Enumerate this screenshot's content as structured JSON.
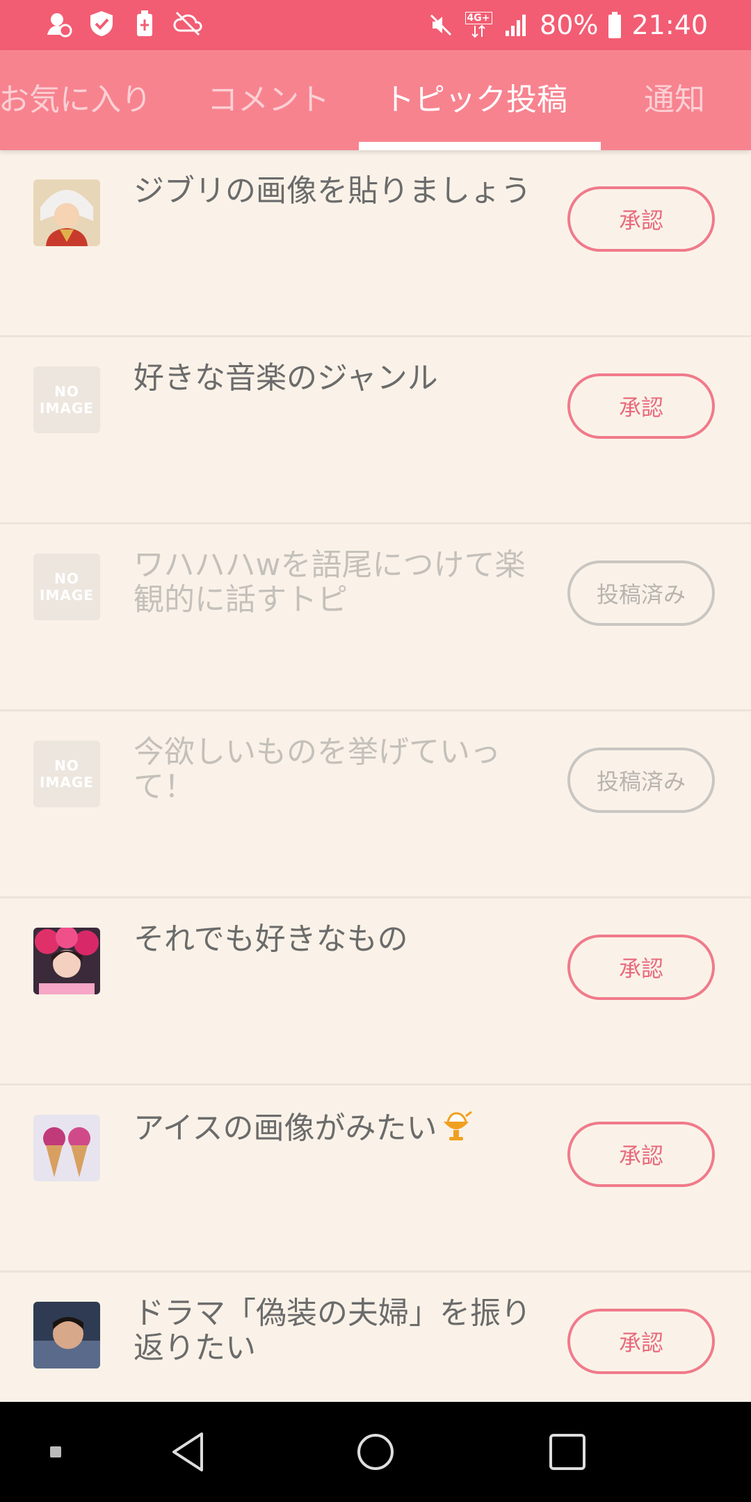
{
  "status": {
    "network": "4G+",
    "battery": "80%",
    "time": "21:40"
  },
  "tabs": [
    {
      "label": "お気に入り",
      "active": false
    },
    {
      "label": "コメント",
      "active": false
    },
    {
      "label": "トピック投稿",
      "active": true
    },
    {
      "label": "通知",
      "active": false
    }
  ],
  "no_image": {
    "line1": "NO",
    "line2": "IMAGE"
  },
  "topics": [
    {
      "title": "ジブリの画像を貼りましょう",
      "button": "承認",
      "thumb": "ghibli-character-image",
      "posted": false
    },
    {
      "title": "好きな音楽のジャンル",
      "button": "承認",
      "thumb": "no-image",
      "posted": false
    },
    {
      "title": "ワハハハwを語尾につけて楽観的に話すトピ",
      "button": "投稿済み",
      "thumb": "no-image",
      "posted": true
    },
    {
      "title": "今欲しいものを挙げていって！",
      "button": "投稿済み",
      "thumb": "no-image",
      "posted": true
    },
    {
      "title": "それでも好きなもの",
      "button": "承認",
      "thumb": "girl-flowers-image",
      "posted": false
    },
    {
      "title": "アイスの画像がみたい",
      "button": "承認",
      "thumb": "ice-cream-image",
      "posted": false,
      "emoji": "ice-cream-icon"
    },
    {
      "title": "ドラマ「偽装の夫婦」を振り返りたい",
      "button": "承認",
      "thumb": "man-sleeping-image",
      "posted": false
    }
  ],
  "colors": {
    "header": "#f25d73",
    "tab_bar": "#f7838f",
    "background": "#faf2e8",
    "accent_button": "#f07a8b",
    "posted_button": "#c9c6c2"
  }
}
